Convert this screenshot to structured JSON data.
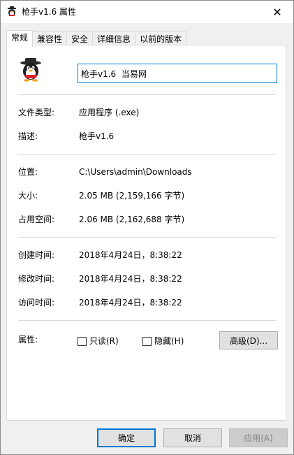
{
  "window": {
    "title": "枪手v1.6 属性",
    "close_glyph": "✕"
  },
  "tabs": [
    {
      "label": "常规",
      "active": true
    },
    {
      "label": "兼容性"
    },
    {
      "label": "安全"
    },
    {
      "label": "详细信息"
    },
    {
      "label": "以前的版本"
    }
  ],
  "general": {
    "file_name": "枪手v1.6  当易网",
    "type_label": "文件类型:",
    "type_value": "应用程序 (.exe)",
    "desc_label": "描述:",
    "desc_value": "枪手v1.6",
    "location_label": "位置:",
    "location_value": "C:\\Users\\admin\\Downloads",
    "size_label": "大小:",
    "size_value": "2.05 MB (2,159,166 字节)",
    "disk_label": "占用空间:",
    "disk_value": "2.06 MB (2,162,688 字节)",
    "created_label": "创建时间:",
    "created_value": "2018年4月24日，8:38:22",
    "modified_label": "修改时间:",
    "modified_value": "2018年4月24日，8:38:22",
    "accessed_label": "访问时间:",
    "accessed_value": "2018年4月24日，8:38:22",
    "attr_label": "属性:",
    "readonly_label": "只读(R)",
    "hidden_label": "隐藏(H)",
    "advanced_label": "高级(D)..."
  },
  "footer": {
    "ok_label": "确定",
    "cancel_label": "取消",
    "apply_label": "应用(A)"
  },
  "colors": {
    "accent": "#0078d7",
    "panel_bg": "#ffffff",
    "window_bg": "#f0f0f0"
  },
  "icons": {
    "app": "penguin-cowboy-icon",
    "close": "close-icon"
  }
}
